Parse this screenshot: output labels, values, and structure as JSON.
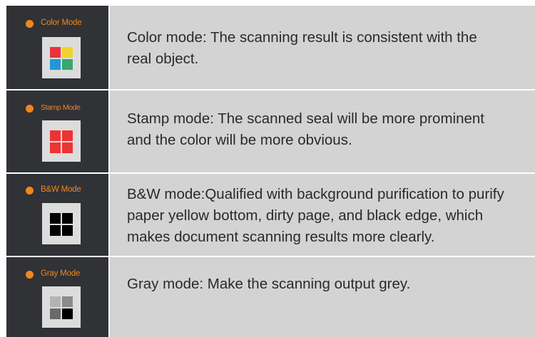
{
  "modes": [
    {
      "label": "Color Mode",
      "icon": "color-mode-icon",
      "colors": [
        "#e8323c",
        "#f2d22e",
        "#2296d8",
        "#3aa76d"
      ],
      "description": "Color mode: The scanning result is consistent with the \n real object."
    },
    {
      "label": "Stamp Mode",
      "icon": "stamp-mode-icon",
      "colors": [
        "#ee3333",
        "#ee3333",
        "#ee3333",
        "#ee3333"
      ],
      "description": "Stamp mode: The scanned seal will be more prominent\nand the color will be more obvious."
    },
    {
      "label": "B&W Mode",
      "icon": "bw-mode-icon",
      "colors": [
        "#000000",
        "#000000",
        "#000000",
        "#000000"
      ],
      "description": "B&W mode:Qualified with background purification to purify\npaper yellow bottom, dirty page, and black edge, which\nmakes document scanning results more clearly."
    },
    {
      "label": "Gray Mode",
      "icon": "gray-mode-icon",
      "colors": [
        "#b3b3b3",
        "#8a8a8a",
        "#6a6a6a",
        "#000000"
      ],
      "description": "Gray mode: Make the scanning output grey."
    }
  ],
  "accent_color": "#f0861e",
  "sidebar_color": "#303236",
  "panel_color": "#d3d3d3"
}
